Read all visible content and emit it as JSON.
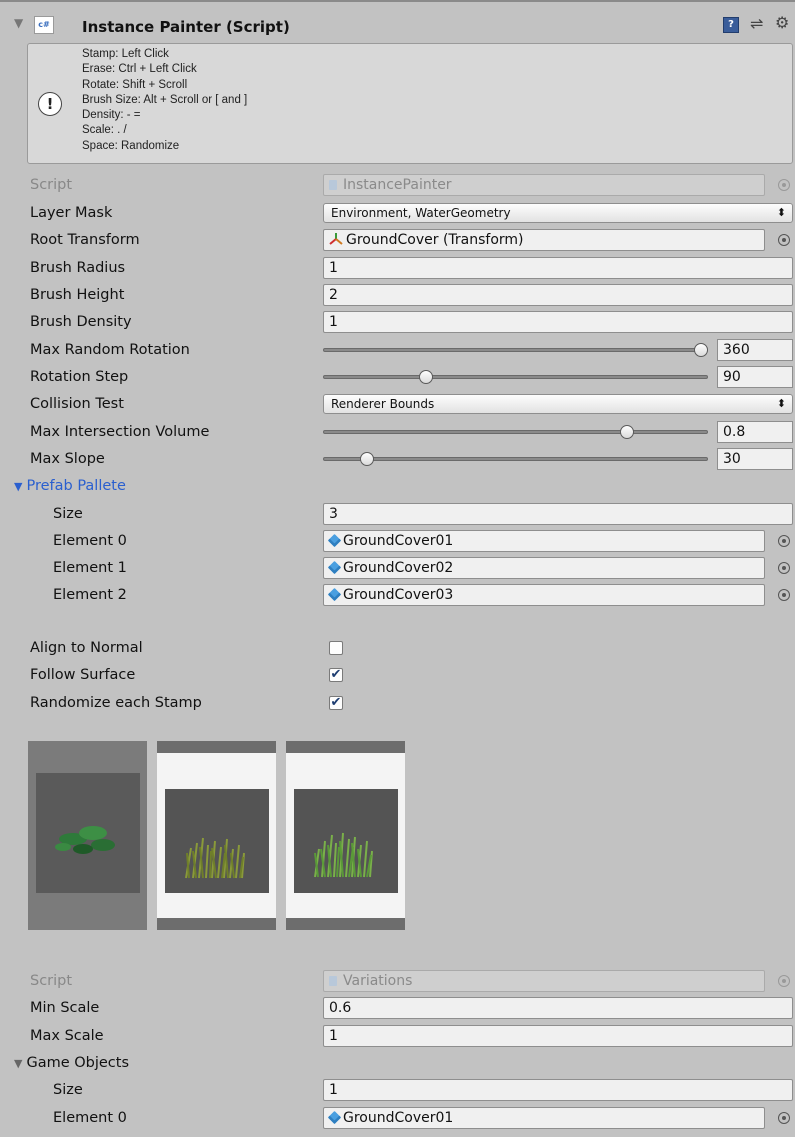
{
  "component": {
    "title": "Instance Painter (Script)"
  },
  "help_box": {
    "lines": [
      "Stamp: Left Click",
      "Erase: Ctrl + Left Click",
      "Rotate: Shift + Scroll",
      "Brush Size: Alt + Scroll or [ and ]",
      "Density: - =",
      "Scale: . /",
      "Space: Randomize"
    ]
  },
  "fields": {
    "script_label": "Script",
    "script_value": "InstancePainter",
    "layer_mask_label": "Layer Mask",
    "layer_mask_value": "Environment, WaterGeometry",
    "root_transform_label": "Root Transform",
    "root_transform_value": "GroundCover (Transform)",
    "brush_radius_label": "Brush Radius",
    "brush_radius_value": "1",
    "brush_height_label": "Brush Height",
    "brush_height_value": "2",
    "brush_density_label": "Brush Density",
    "brush_density_value": "1",
    "max_random_rotation_label": "Max Random Rotation",
    "max_random_rotation_value": "360",
    "rotation_step_label": "Rotation Step",
    "rotation_step_value": "90",
    "collision_test_label": "Collision Test",
    "collision_test_value": "Renderer Bounds",
    "max_intersection_volume_label": "Max Intersection Volume",
    "max_intersection_volume_value": "0.8",
    "max_slope_label": "Max Slope",
    "max_slope_value": "30"
  },
  "sliders": {
    "max_random_rotation": 1.0,
    "rotation_step": 0.26,
    "max_intersection_volume": 0.8,
    "max_slope": 0.1
  },
  "prefab_pallete": {
    "label": "Prefab Pallete",
    "size_label": "Size",
    "size_value": "3",
    "elements": [
      {
        "label": "Element 0",
        "value": "GroundCover01"
      },
      {
        "label": "Element 1",
        "value": "GroundCover02"
      },
      {
        "label": "Element 2",
        "value": "GroundCover03"
      }
    ]
  },
  "toggles": {
    "align_to_normal_label": "Align to Normal",
    "align_to_normal": false,
    "follow_surface_label": "Follow Surface",
    "follow_surface": true,
    "randomize_each_stamp_label": "Randomize each Stamp",
    "randomize_each_stamp": true
  },
  "variations": {
    "script_label": "Script",
    "script_value": "Variations",
    "min_scale_label": "Min Scale",
    "min_scale_value": "0.6",
    "max_scale_label": "Max Scale",
    "max_scale_value": "1",
    "game_objects_label": "Game Objects",
    "size_label": "Size",
    "size_value": "1",
    "element0_label": "Element 0",
    "element0_value": "GroundCover01"
  },
  "icons": {
    "check": "✔",
    "dropdown_arrow": "⬍",
    "fold_open": "▼",
    "help": "?",
    "warning": "!"
  },
  "colors": {
    "inspector_bg": "#c2c2c2",
    "accent_blue": "#2a5fcf"
  }
}
